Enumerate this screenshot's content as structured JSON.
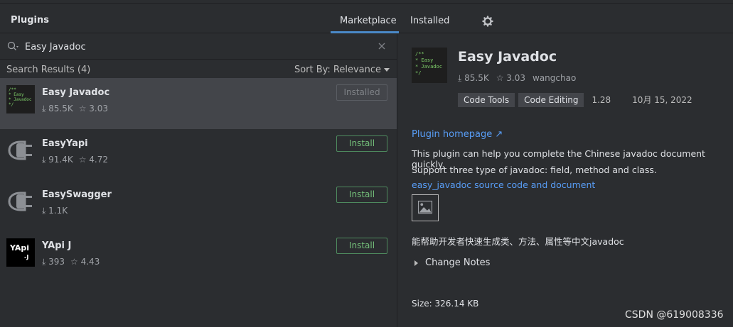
{
  "header": {
    "title": "Plugins",
    "tabs": [
      {
        "label": "Marketplace",
        "active": true
      },
      {
        "label": "Installed",
        "active": false
      }
    ],
    "settings_icon": "gear-icon"
  },
  "search": {
    "value": "Easy Javadoc",
    "icon": "search-icon",
    "clear_icon": "close-icon"
  },
  "results": {
    "count_label": "Search Results (4)",
    "sort_label": "Sort By: Relevance"
  },
  "plugins": [
    {
      "name": "Easy Javadoc",
      "downloads": "⤓ 85.5K",
      "rating": "☆ 3.03",
      "button": "Installed",
      "icon": "easy-javadoc-icon",
      "icon_text": [
        "/**",
        " * Easy",
        " * Javadoc",
        " */"
      ]
    },
    {
      "name": "EasyYapi",
      "downloads": "⤓ 91.4K",
      "rating": "☆ 4.72",
      "button": "Install",
      "icon": "plug-icon"
    },
    {
      "name": "EasySwagger",
      "downloads": "⤓ 1.1K",
      "rating": "",
      "button": "Install",
      "icon": "plug-icon"
    },
    {
      "name": "YApi J",
      "downloads": "⤓ 393",
      "rating": "☆ 4.43",
      "button": "Install",
      "icon": "yapi-icon",
      "icon_text": "YApi"
    }
  ],
  "detail": {
    "name": "Easy Javadoc",
    "icon_text": [
      "/**",
      " * Easy",
      " * Javadoc",
      " */"
    ],
    "downloads": "⤓ 85.5K",
    "rating": "☆ 3.03",
    "vendor": "wangchao",
    "tags": [
      "Code Tools",
      "Code Editing"
    ],
    "version": "1.28",
    "date": "10月 15, 2022",
    "homepage": "Plugin homepage ↗",
    "description_1": "This plugin can help you complete the Chinese javadoc document quickly.",
    "description_2": "Support three type of javadoc: field, method and class.",
    "source_link": "easy_javadoc source code and document",
    "chinese_desc": "能帮助开发者快速生成类、方法、属性等中文javadoc",
    "change_notes": "Change Notes",
    "size": "Size: 326.14 KB"
  },
  "watermark": "CSDN @619008336",
  "colors": {
    "accent": "#4a88c7",
    "install_green": "#73bd79",
    "link": "#589df6"
  }
}
